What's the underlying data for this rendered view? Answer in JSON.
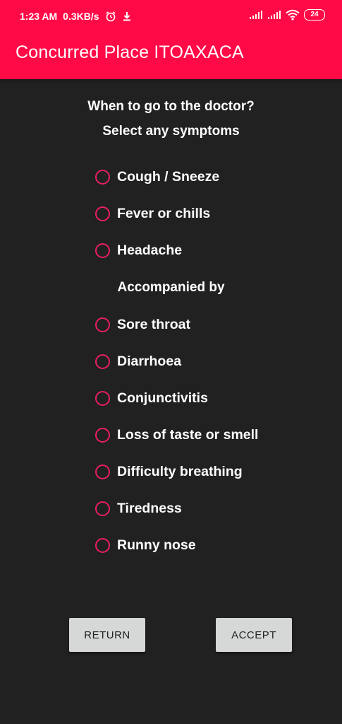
{
  "status_bar": {
    "time": "1:23 AM",
    "speed": "0.3KB/s",
    "alarm_icon": "alarm-icon",
    "download_icon": "download-icon",
    "signal_icons": [
      "signal-icon",
      "signal-icon"
    ],
    "wifi_icon": "wifi-icon",
    "battery": "24"
  },
  "app_bar": {
    "title": "Concurred Place ITOAXACA"
  },
  "form": {
    "question": "When to go to the doctor?",
    "subtitle": "Select any symptoms",
    "main_symptoms": [
      "Cough / Sneeze",
      "Fever or chills",
      "Headache"
    ],
    "accompanied_label": "Accompanied by",
    "secondary_symptoms": [
      "Sore throat",
      "Diarrhoea",
      "Conjunctivitis",
      "Loss of taste or smell",
      "Difficulty breathing",
      "Tiredness",
      "Runny nose"
    ]
  },
  "buttons": {
    "return_label": "RETURN",
    "accept_label": "ACCEPT"
  },
  "colors": {
    "app_bar": "#FF0A47",
    "background": "#212121",
    "radio": "#E91E63",
    "button": "#D6D7D7"
  }
}
